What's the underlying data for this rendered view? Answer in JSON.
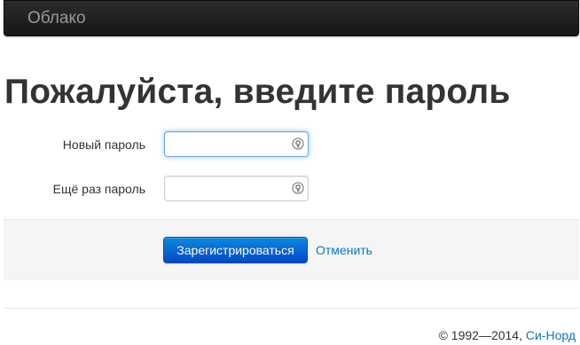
{
  "navbar": {
    "brand": "Облако"
  },
  "page": {
    "title": "Пожалуйста, введите пароль"
  },
  "form": {
    "new_password": {
      "label": "Новый пароль",
      "value": "",
      "focused": true,
      "icon": "key-icon"
    },
    "repeat_password": {
      "label": "Ещё раз пароль",
      "value": "",
      "icon": "key-icon"
    },
    "submit_label": "Зарегистрироваться",
    "cancel_label": "Отменить"
  },
  "footer": {
    "copyright": "© 1992—2014,",
    "company_link": "Си-Норд"
  },
  "colors": {
    "navbar_bg": "#1b1b1b",
    "brand_text": "#999999",
    "primary_button": "#0a5fd4",
    "link": "#0b76c5",
    "focus_glow": "#52a8ec",
    "actions_bg": "#f5f5f5"
  }
}
